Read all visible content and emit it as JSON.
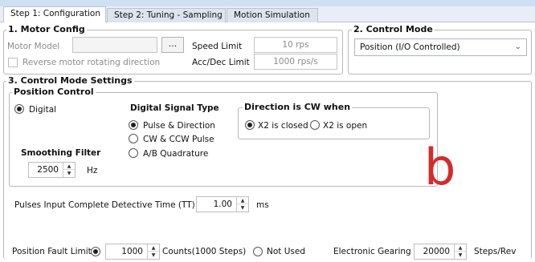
{
  "tabs": [
    {
      "label": "Step 1: Configuration",
      "active": true
    },
    {
      "label": "Step 2: Tuning - Sampling",
      "active": false
    },
    {
      "label": "Motion Simulation",
      "active": false
    }
  ],
  "motor_config": {
    "legend": "1. Motor Config",
    "motor_model_label": "Motor Model",
    "motor_model_value": "",
    "browse_label": "...",
    "speed_limit_label": "Speed Limit",
    "speed_limit_value": "10 rps",
    "reverse_label": "Reverse motor rotating direction",
    "reverse_checked": false,
    "accdec_label": "Acc/Dec Limit",
    "accdec_value": "1000 rps/s"
  },
  "control_mode": {
    "legend": "2. Control Mode",
    "selected": "Position (I/O Controlled)"
  },
  "settings": {
    "legend": "3. Control Mode Settings",
    "position_control_label": "Position Control",
    "digital_label": "Digital",
    "signal_type": {
      "title": "Digital Signal Type",
      "options": [
        "Pulse & Direction",
        "CW & CCW Pulse",
        "A/B Quadrature"
      ],
      "selected_index": 0
    },
    "direction": {
      "title": "Direction is CW when",
      "options": [
        "X2 is closed",
        "X2 is open"
      ],
      "selected_index": 0
    },
    "smoothing": {
      "title": "Smoothing Filter",
      "value": "2500",
      "unit": "Hz"
    },
    "pulses_input": {
      "label": "Pulses Input Complete Detective Time (TT)",
      "value": "1.00",
      "unit": "ms"
    },
    "fault_limit": {
      "label": "Position Fault Limit",
      "value": "1000",
      "unit": "Counts(1000 Steps)",
      "not_used_label": "Not Used"
    },
    "gearing": {
      "label": "Electronic Gearing",
      "value": "20000",
      "unit": "Steps/Rev"
    }
  },
  "overlay_letter": "b"
}
